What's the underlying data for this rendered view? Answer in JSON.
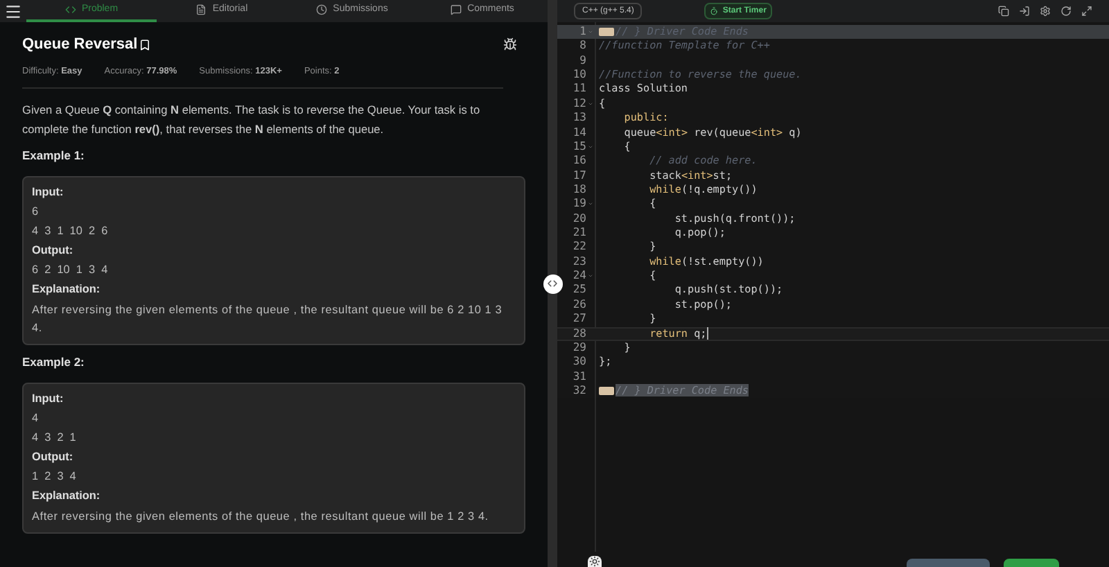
{
  "tabs": [
    {
      "label": "Problem",
      "selected": true
    },
    {
      "label": "Editorial",
      "selected": false
    },
    {
      "label": "Submissions",
      "selected": false
    },
    {
      "label": "Comments",
      "selected": false
    }
  ],
  "problem": {
    "title": "Queue Reversal",
    "meta": [
      {
        "label": "Difficulty:",
        "value": "Easy"
      },
      {
        "label": "Accuracy:",
        "value": "77.98%"
      },
      {
        "label": "Submissions:",
        "value": "123K+"
      },
      {
        "label": "Points:",
        "value": "2"
      }
    ],
    "description": "Given a Queue **Q** containing **N** elements. The task is to reverse the Queue. Your task is to complete the function **rev()**, that reverses the **N** elements of the queue.",
    "examples": [
      {
        "heading": "Example 1:",
        "input_label": "Input:",
        "input": [
          "6",
          "4  3  1  10  2  6"
        ],
        "output_label": "Output:",
        "output": "6  2  10  1  3  4",
        "explanation_label": "Explanation:",
        "explanation": "After reversing the given elements of the queue , the resultant queue will be 6 2 10 1 3 4."
      },
      {
        "heading": "Example 2:",
        "input_label": "Input:",
        "input": [
          "4",
          "4  3  2  1"
        ],
        "output_label": "Output:",
        "output": "1  2  3  4",
        "explanation_label": "Explanation:",
        "explanation": "After reversing the given elements of the queue , the resultant queue will be 1 2 3 4."
      }
    ]
  },
  "editor": {
    "language": "C++ (g++ 5.4)",
    "timer": "Start Timer",
    "lines": [
      {
        "number": "1",
        "foldable": true,
        "folded": true,
        "active": false,
        "highlighted": true,
        "tokens": [
          {
            "text": "// } Driver Code Ends",
            "kind": "comment"
          }
        ]
      },
      {
        "number": "8",
        "foldable": false,
        "folded": false,
        "active": false,
        "highlighted": false,
        "tokens": [
          {
            "text": "//function Template for C++",
            "kind": "comment"
          }
        ]
      },
      {
        "number": "9",
        "foldable": false,
        "folded": false,
        "active": false,
        "highlighted": false
      },
      {
        "number": "10",
        "foldable": false,
        "folded": false,
        "active": false,
        "highlighted": false,
        "tokens": [
          {
            "text": "//Function to reverse the queue.",
            "kind": "comment"
          }
        ]
      },
      {
        "number": "11",
        "foldable": false,
        "folded": false,
        "active": false,
        "highlighted": false,
        "tokens": [
          {
            "text": "class Solution",
            "kind": "plain"
          }
        ]
      },
      {
        "number": "12",
        "foldable": true,
        "folded": false,
        "active": false,
        "highlighted": false,
        "tokens": [
          {
            "text": "{",
            "kind": "plain"
          }
        ]
      },
      {
        "number": "13",
        "foldable": false,
        "folded": false,
        "active": false,
        "highlighted": false,
        "tokens": [
          {
            "text": "    public:",
            "kind": "keyword"
          }
        ]
      },
      {
        "number": "14",
        "foldable": false,
        "folded": false,
        "active": false,
        "highlighted": false,
        "tokens": [
          {
            "text": "    queue",
            "kind": "plain"
          },
          {
            "text": "<int>",
            "kind": "keyword"
          },
          {
            "text": " rev(queue",
            "kind": "plain"
          },
          {
            "text": "<int>",
            "kind": "keyword"
          },
          {
            "text": " q)",
            "kind": "plain"
          }
        ]
      },
      {
        "number": "15",
        "foldable": true,
        "folded": false,
        "active": false,
        "highlighted": false,
        "tokens": [
          {
            "text": "    {",
            "kind": "plain"
          }
        ]
      },
      {
        "number": "16",
        "foldable": false,
        "folded": false,
        "active": false,
        "highlighted": false,
        "tokens": [
          {
            "text": "        // add code here.",
            "kind": "comment"
          }
        ]
      },
      {
        "number": "17",
        "foldable": false,
        "folded": false,
        "active": false,
        "highlighted": false,
        "tokens": [
          {
            "text": "        stack",
            "kind": "plain"
          },
          {
            "text": "<int>",
            "kind": "keyword"
          },
          {
            "text": "st;",
            "kind": "plain"
          }
        ]
      },
      {
        "number": "18",
        "foldable": false,
        "folded": false,
        "active": false,
        "highlighted": false,
        "tokens": [
          {
            "text": "        while",
            "kind": "keyword"
          },
          {
            "text": "(!q.empty())",
            "kind": "plain"
          }
        ]
      },
      {
        "number": "19",
        "foldable": true,
        "folded": false,
        "active": false,
        "highlighted": false,
        "tokens": [
          {
            "text": "        {",
            "kind": "plain"
          }
        ]
      },
      {
        "number": "20",
        "foldable": false,
        "folded": false,
        "active": false,
        "highlighted": false,
        "tokens": [
          {
            "text": "            st.push(q.front());",
            "kind": "plain"
          }
        ]
      },
      {
        "number": "21",
        "foldable": false,
        "folded": false,
        "active": false,
        "highlighted": false,
        "tokens": [
          {
            "text": "            q.pop();",
            "kind": "plain"
          }
        ]
      },
      {
        "number": "22",
        "foldable": false,
        "folded": false,
        "active": false,
        "highlighted": false,
        "tokens": [
          {
            "text": "        }",
            "kind": "plain"
          }
        ]
      },
      {
        "number": "23",
        "foldable": false,
        "folded": false,
        "active": false,
        "highlighted": false,
        "tokens": [
          {
            "text": "        while",
            "kind": "keyword"
          },
          {
            "text": "(!st.empty())",
            "kind": "plain"
          }
        ]
      },
      {
        "number": "24",
        "foldable": true,
        "folded": false,
        "active": false,
        "highlighted": false,
        "tokens": [
          {
            "text": "        {",
            "kind": "plain"
          }
        ]
      },
      {
        "number": "25",
        "foldable": false,
        "folded": false,
        "active": false,
        "highlighted": false,
        "tokens": [
          {
            "text": "            q.push(st.top());",
            "kind": "plain"
          }
        ]
      },
      {
        "number": "26",
        "foldable": false,
        "folded": false,
        "active": false,
        "highlighted": false,
        "tokens": [
          {
            "text": "            st.pop();",
            "kind": "plain"
          }
        ]
      },
      {
        "number": "27",
        "foldable": false,
        "folded": false,
        "active": false,
        "highlighted": false,
        "tokens": [
          {
            "text": "        }",
            "kind": "plain"
          }
        ]
      },
      {
        "number": "28",
        "foldable": false,
        "folded": false,
        "active": true,
        "highlighted": false,
        "tokens": [
          {
            "text": "        return",
            "kind": "keyword"
          },
          {
            "text": " q;",
            "kind": "plain"
          }
        ]
      },
      {
        "number": "29",
        "foldable": false,
        "folded": false,
        "active": false,
        "highlighted": false,
        "tokens": [
          {
            "text": "    }",
            "kind": "plain"
          }
        ]
      },
      {
        "number": "30",
        "foldable": false,
        "folded": false,
        "active": false,
        "highlighted": false,
        "tokens": [
          {
            "text": "};",
            "kind": "plain"
          }
        ]
      },
      {
        "number": "31",
        "foldable": false,
        "folded": false,
        "active": false,
        "highlighted": false
      },
      {
        "number": "32",
        "foldable": false,
        "folded": true,
        "active": false,
        "highlighted": false,
        "tokens": [
          {
            "text": "// } Driver Code Ends",
            "kind": "selected-comment"
          }
        ]
      }
    ]
  }
}
